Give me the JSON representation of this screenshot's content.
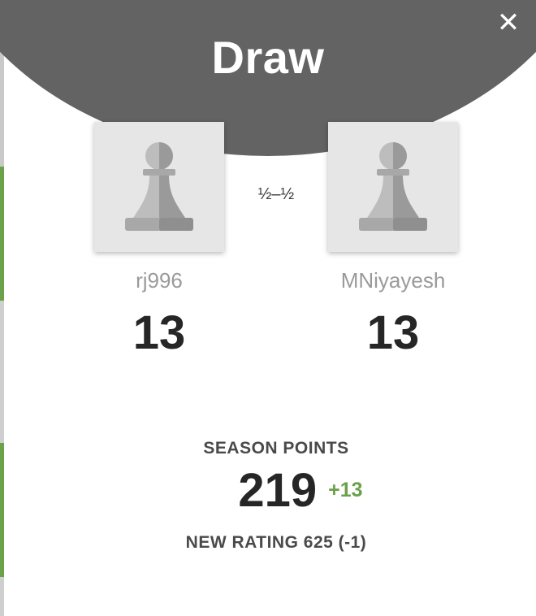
{
  "header": {
    "title": "Draw",
    "close_label": "✕"
  },
  "match": {
    "result": "½–½"
  },
  "players": [
    {
      "username": "rj996",
      "points": "13",
      "avatar_icon": "pawn-icon"
    },
    {
      "username": "MNiyayesh",
      "points": "13",
      "avatar_icon": "pawn-icon"
    }
  ],
  "season": {
    "label": "SEASON POINTS",
    "value": "219",
    "delta": "+13"
  },
  "rating": {
    "text": "NEW RATING 625 (-1)"
  },
  "colors": {
    "header": "#636363",
    "accent_green": "#6aa14a",
    "avatar_bg": "#e6e6e6"
  }
}
